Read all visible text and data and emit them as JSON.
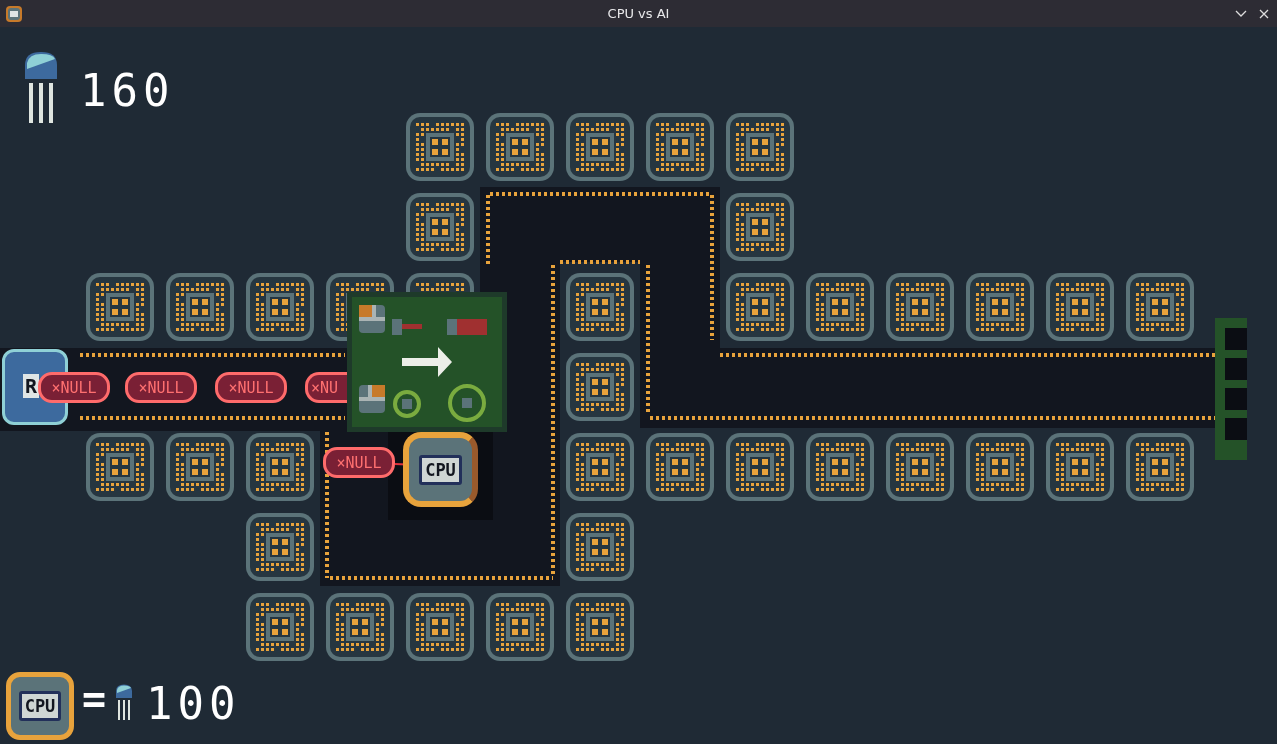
{
  "window": {
    "title": "CPU vs AI"
  },
  "hud": {
    "memory": "160"
  },
  "base": {
    "label": "R"
  },
  "enemies": [
    {
      "label": "×NULL",
      "cut": false
    },
    {
      "label": "×NULL",
      "cut": false
    },
    {
      "label": "×NULL",
      "cut": false
    },
    {
      "label": "×NU",
      "cut": true
    },
    {
      "label": "×NULL",
      "cut": false
    }
  ],
  "tower": {
    "label": "CPU"
  },
  "shop": {
    "label": "CPU",
    "equals": "=",
    "cost": "100"
  }
}
